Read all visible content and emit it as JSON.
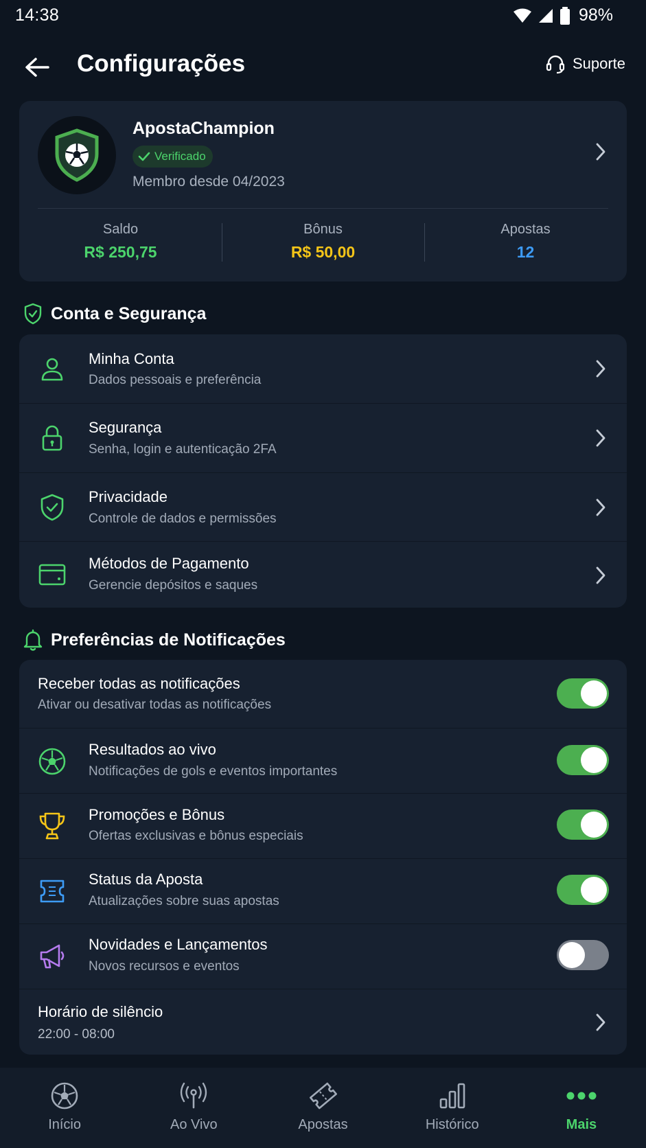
{
  "status_bar": {
    "time": "14:38",
    "battery": "98%"
  },
  "header": {
    "title": "Configurações",
    "support_label": "Suporte"
  },
  "profile": {
    "username": "ApostaChampion",
    "verified_label": "Verificado",
    "member_since": "Membro desde 04/2023",
    "stats": [
      {
        "label": "Saldo",
        "value": "R$ 250,75",
        "color": "#4cd46c"
      },
      {
        "label": "Bônus",
        "value": "R$ 50,00",
        "color": "#f5c518"
      },
      {
        "label": "Apostas",
        "value": "12",
        "color": "#3d9bf5"
      }
    ]
  },
  "account_section": {
    "title": "Conta e Segurança",
    "items": [
      {
        "title": "Minha Conta",
        "subtitle": "Dados pessoais e preferência",
        "icon": "user-icon"
      },
      {
        "title": "Segurança",
        "subtitle": "Senha, login e autenticação 2FA",
        "icon": "lock-icon"
      },
      {
        "title": "Privacidade",
        "subtitle": "Controle de dados e permissões",
        "icon": "shield-check-icon"
      },
      {
        "title": "Métodos de Pagamento",
        "subtitle": "Gerencie depósitos e saques",
        "icon": "credit-card-icon"
      }
    ]
  },
  "notifications_section": {
    "title": "Preferências de Notificações",
    "master": {
      "title": "Receber todas as notificações",
      "subtitle": "Ativar ou desativar todas as notificações",
      "enabled": true
    },
    "items": [
      {
        "title": "Resultados ao vivo",
        "subtitle": "Notificações de gols e eventos importantes",
        "icon": "soccer-ball-icon",
        "enabled": true
      },
      {
        "title": "Promoções e Bônus",
        "subtitle": "Ofertas exclusivas e bônus especiais",
        "icon": "trophy-icon",
        "enabled": true
      },
      {
        "title": "Status da Aposta",
        "subtitle": "Atualizações sobre suas apostas",
        "icon": "ticket-icon",
        "enabled": true
      },
      {
        "title": "Novidades e Lançamentos",
        "subtitle": "Novos recursos e eventos",
        "icon": "megaphone-icon",
        "enabled": false
      }
    ],
    "quiet_hours": {
      "title": "Horário de silêncio",
      "value": "22:00 - 08:00"
    }
  },
  "bottom_nav": {
    "items": [
      {
        "label": "Início",
        "icon": "soccer-ball-icon"
      },
      {
        "label": "Ao Vivo",
        "icon": "live-broadcast-icon"
      },
      {
        "label": "Apostas",
        "icon": "ticket-icon"
      },
      {
        "label": "Histórico",
        "icon": "bar-chart-icon"
      },
      {
        "label": "Mais",
        "icon": "more-dots-icon",
        "active": true
      }
    ]
  },
  "colors": {
    "background": "#0d1520",
    "card": "#172130",
    "accent_green": "#4cd46c",
    "toggle_on": "#4caf50",
    "toggle_off": "#7a808a",
    "gold": "#f5c518",
    "blue": "#3d9bf5",
    "purple": "#b57bee"
  }
}
